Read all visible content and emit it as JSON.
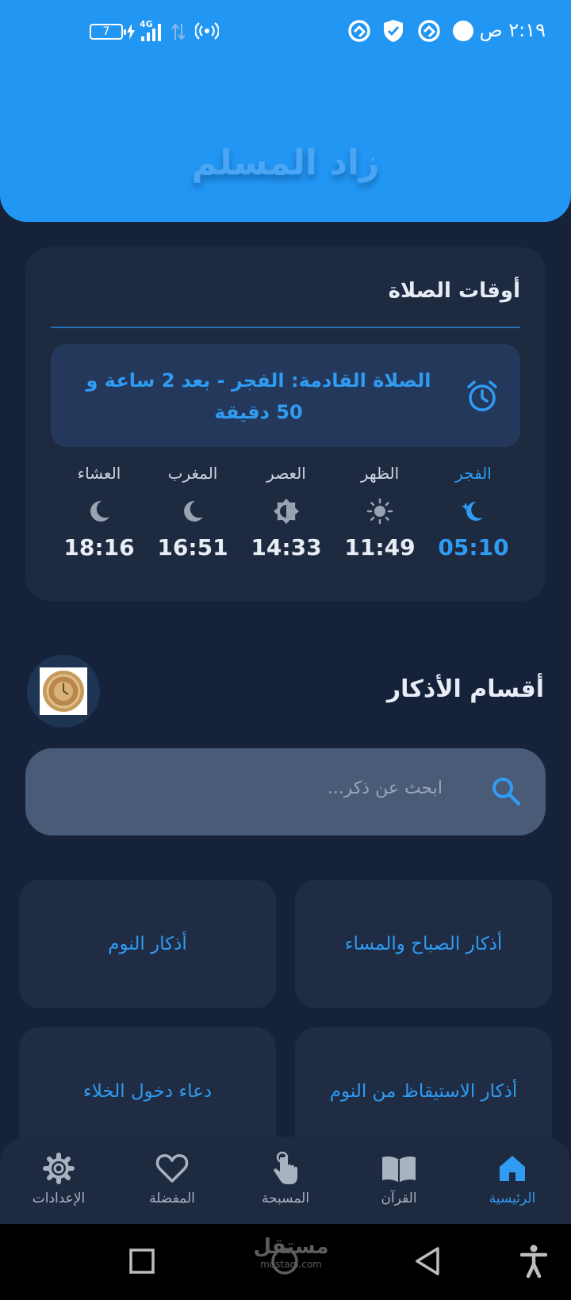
{
  "status_bar": {
    "time": "٢:١٩ ص",
    "battery": "7",
    "network": "4G"
  },
  "header": {
    "title": "زاد المسلم"
  },
  "prayer_card": {
    "title": "أوقات الصلاة",
    "next_prayer_text": "الصلاة القادمة: الفجر - بعد 2 ساعة و 50 دقيقة",
    "times": [
      {
        "name": "الفجر",
        "time": "05:10",
        "icon": "moon-star-icon",
        "active": true
      },
      {
        "name": "الظهر",
        "time": "11:49",
        "icon": "sun-icon",
        "active": false
      },
      {
        "name": "العصر",
        "time": "14:33",
        "icon": "brightness-icon",
        "active": false
      },
      {
        "name": "المغرب",
        "time": "16:51",
        "icon": "moon-icon",
        "active": false
      },
      {
        "name": "العشاء",
        "time": "18:16",
        "icon": "moon-icon",
        "active": false
      }
    ]
  },
  "adhkar": {
    "title": "أقسام الأذكار",
    "search_placeholder": "ابحث عن ذكر...",
    "categories": [
      "أذكار الصباح والمساء",
      "أذكار النوم",
      "أذكار الاستيقاظ من النوم",
      "دعاء دخول الخلاء"
    ]
  },
  "bottom_nav": [
    {
      "label": "الرئيسية",
      "icon": "home-icon",
      "active": true
    },
    {
      "label": "القرآن",
      "icon": "book-icon",
      "active": false
    },
    {
      "label": "المسبحة",
      "icon": "tap-hand-icon",
      "active": false
    },
    {
      "label": "المفضلة",
      "icon": "heart-icon",
      "active": false
    },
    {
      "label": "الإعدادات",
      "icon": "gear-icon",
      "active": false
    }
  ],
  "watermark": {
    "main": "مستقل",
    "sub": "mostaql.com"
  },
  "colors": {
    "accent": "#2196f3",
    "background": "#15223a",
    "card": "#1d2a40",
    "active_text": "#2f9bf2"
  }
}
